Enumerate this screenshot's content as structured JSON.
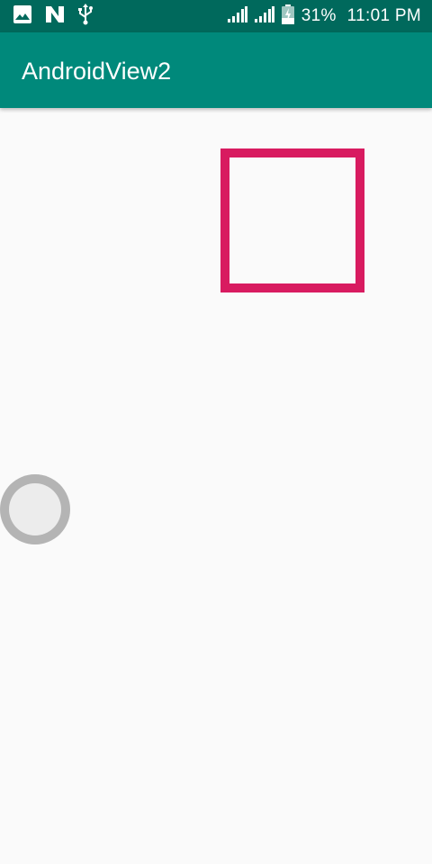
{
  "status_bar": {
    "notification_icons": [
      "image-icon",
      "n-icon",
      "usb-icon"
    ],
    "signal_icons": [
      "signal-icon",
      "signal-icon"
    ],
    "battery_icon": "battery-charging-icon",
    "battery_text": "31%",
    "time": "11:01 PM",
    "color": "#00695c"
  },
  "app_bar": {
    "title": "AndroidView2",
    "color": "#00897b"
  },
  "content": {
    "square_color": "#d81b60",
    "thumb_color": "#b4b4b4"
  }
}
